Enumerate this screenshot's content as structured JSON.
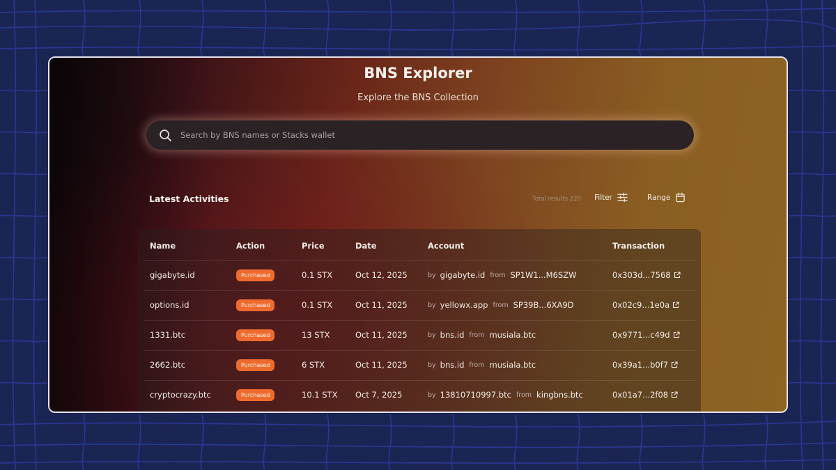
{
  "app": {
    "title": "BNS Explorer",
    "subtitle": "Explore the BNS Collection"
  },
  "search": {
    "placeholder": "Search by BNS names or Stacks wallet",
    "icon": "search-icon"
  },
  "activities": {
    "title": "Latest Activities",
    "total_results": "Total results 220",
    "filter_label": "Filter",
    "range_label": "Range"
  },
  "table": {
    "columns": [
      "Name",
      "Action",
      "Price",
      "Date",
      "Account",
      "Transaction"
    ],
    "rows": [
      {
        "name": "gigabyte.id",
        "action": "Purchased",
        "price": "0.1 STX",
        "date": "Oct 12, 2025",
        "by_label": "by",
        "by": "gigabyte.id",
        "from_label": "from",
        "from": "SP1W1...M6SZW",
        "tx": "0x303d...7568"
      },
      {
        "name": "options.id",
        "action": "Purchased",
        "price": "0.1 STX",
        "date": "Oct 11, 2025",
        "by_label": "by",
        "by": "yellowx.app",
        "from_label": "from",
        "from": "SP39B...6XA9D",
        "tx": "0x02c9...1e0a"
      },
      {
        "name": "1331.btc",
        "action": "Purchased",
        "price": "13 STX",
        "date": "Oct 11, 2025",
        "by_label": "by",
        "by": "bns.id",
        "from_label": "from",
        "from": "musiala.btc",
        "tx": "0x9771...c49d"
      },
      {
        "name": "2662.btc",
        "action": "Purchased",
        "price": "6 STX",
        "date": "Oct 11, 2025",
        "by_label": "by",
        "by": "bns.id",
        "from_label": "from",
        "from": "musiala.btc",
        "tx": "0x39a1...b0f7"
      },
      {
        "name": "cryptocrazy.btc",
        "action": "Purchased",
        "price": "10.1 STX",
        "date": "Oct 7, 2025",
        "by_label": "by",
        "by": "13810710997.btc",
        "from_label": "from",
        "from": "kingbns.btc",
        "tx": "0x01a7...2f08"
      }
    ]
  },
  "colors": {
    "background": "#1b2554",
    "grid_lines": "#2f3fa8",
    "badge": "#ef6b2d",
    "frame_border": "#e6e3ec"
  }
}
